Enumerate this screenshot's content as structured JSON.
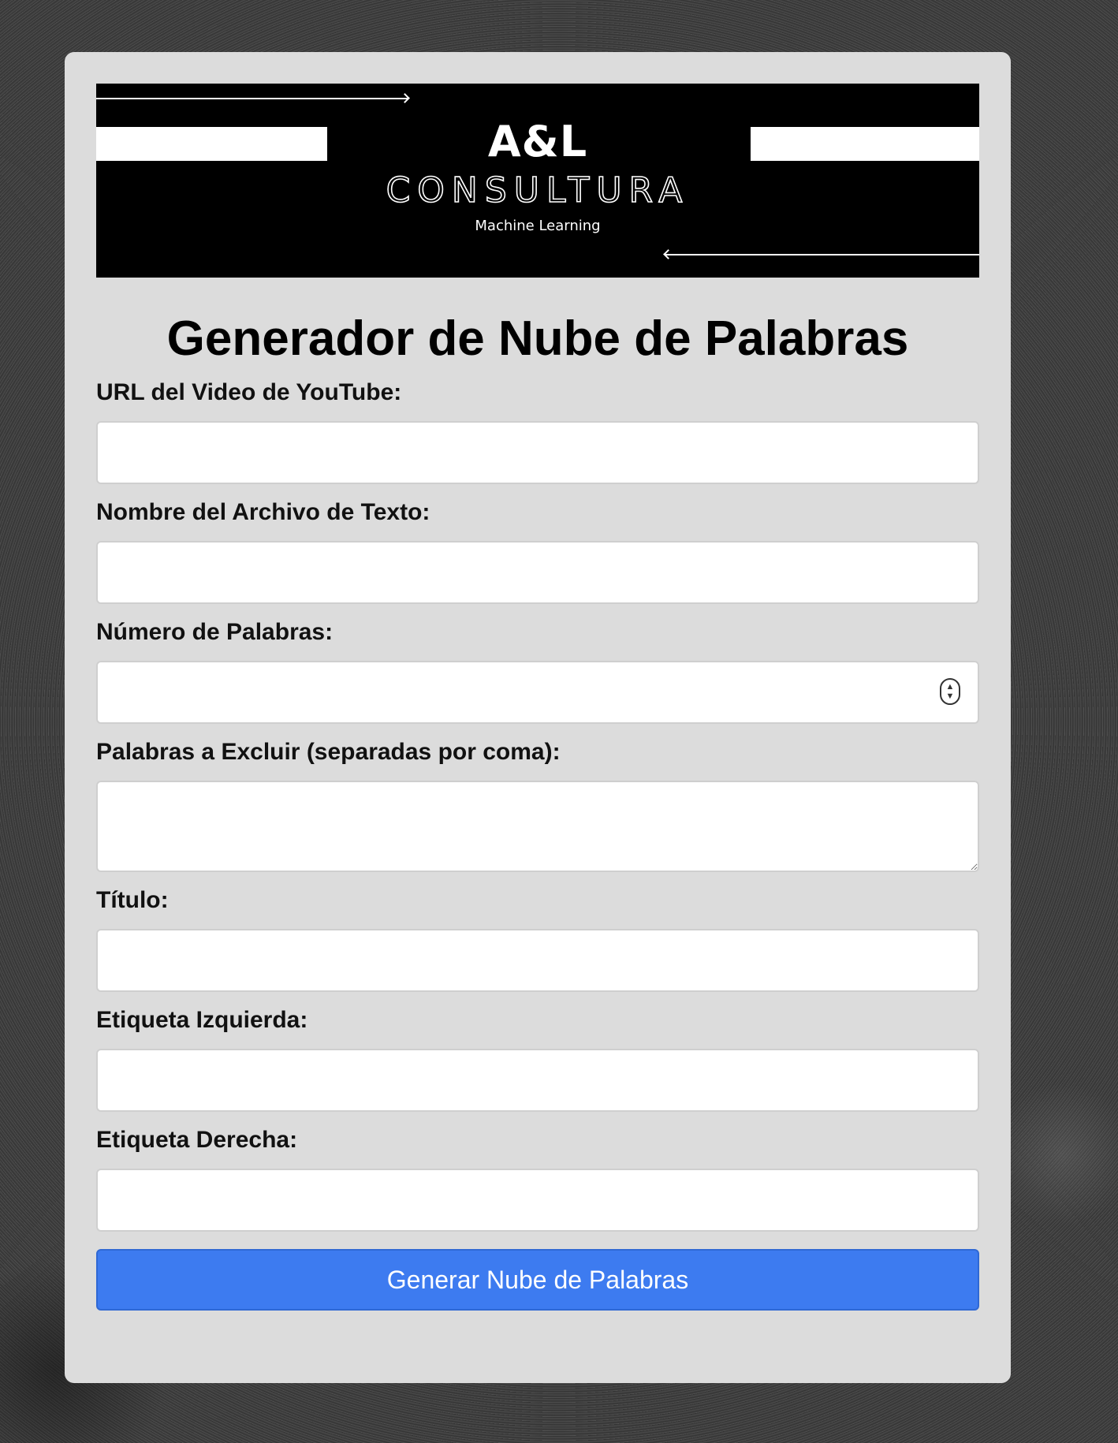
{
  "banner": {
    "brand_main": "A&L",
    "brand_sub": "CONSULTURA",
    "brand_tag": "Machine Learning"
  },
  "page_title": "Generador de Nube de Palabras",
  "form": {
    "url_label": "URL del Video de YouTube:",
    "url_value": "",
    "filename_label": "Nombre del Archivo de Texto:",
    "filename_value": "",
    "word_count_label": "Número de Palabras:",
    "word_count_value": "",
    "exclude_label": "Palabras a Excluir (separadas por coma):",
    "exclude_value": "",
    "title_label": "Título:",
    "title_value": "",
    "left_label_label": "Etiqueta Izquierda:",
    "left_label_value": "",
    "right_label_label": "Etiqueta Derecha:",
    "right_label_value": "",
    "submit_label": "Generar Nube de Palabras"
  },
  "colors": {
    "accent": "#3d7bf0",
    "card_background": "#dcdcdc",
    "banner_background": "#000000"
  },
  "icons": {
    "stepper": "up-down-stepper-icon"
  }
}
